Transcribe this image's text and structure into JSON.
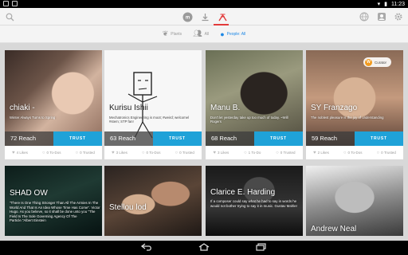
{
  "statusbar": {
    "time": "11:23"
  },
  "appbar": {
    "icons": [
      "search-icon",
      "brand-icon",
      "download-icon",
      "target-icon",
      "globe-icon",
      "profile-icon",
      "gear-icon"
    ],
    "accent": "#e23b3b"
  },
  "filters": [
    {
      "label": "Plants",
      "icon": "leaf-icon",
      "active": false
    },
    {
      "label": "All",
      "icon": "people-icon",
      "active": false
    },
    {
      "label": "People: All",
      "icon": "person-icon",
      "active": true
    }
  ],
  "cards": [
    {
      "name": "chiaki -",
      "bio": "Winter Always Turns to Spring",
      "reach": "72 Reach",
      "trust": "TRUST",
      "likes": "4 Likes",
      "todos": "0 To-Dos",
      "trusted": "0 Trusted"
    },
    {
      "name": "Kurisu Ishii",
      "bio": "Mechatronics Engineering is moot; #weird; welcomel #stem; STP fan!",
      "reach": "63 Reach",
      "trust": "TRUST",
      "likes": "3 Likes",
      "todos": "0 To-Dos",
      "trusted": "0 Trusted"
    },
    {
      "name": "Manu B.",
      "bio": "Don't let yesterday take up too much of today. ~Will Rogers",
      "reach": "68 Reach",
      "trust": "TRUST",
      "likes": "3 Likes",
      "todos": "1 To-Do",
      "trusted": "0 Trusted"
    },
    {
      "name": "SY Franzago",
      "bio": "The noblest pleasure is the joy of understanding",
      "reach": "59 Reach",
      "trust": "TRUST",
      "likes": "2 Likes",
      "todos": "0 To-Dos",
      "trusted": "0 Trusted",
      "badge": "Curator"
    }
  ],
  "cards_row2": [
    {
      "name": "SHAD OW",
      "bio": "\"There Is One Thing Stronger Than All The Armies In The World And That Is An Idea Whose Time Has Come\". Victor Hugo. As you believe, so it shall be done unto you \"The Field Is The Sole Governing Agency Of The Particle.\"Albert Einstein"
    },
    {
      "name": "Stellou lod",
      "bio": ""
    },
    {
      "name": "Clarice E. Harding",
      "bio": "If a composer could say what he had to say in words he would not bother trying to say it in music. Gustav Mahler"
    },
    {
      "name": "Andrew Neal",
      "bio": ""
    }
  ],
  "colors": {
    "trust_button": "#1fa2d8",
    "reach_bg": "#3c3c3c",
    "active_filter": "#1e88e5"
  },
  "navbar": {
    "back": "back-icon",
    "home": "home-icon",
    "recents": "recents-icon"
  }
}
